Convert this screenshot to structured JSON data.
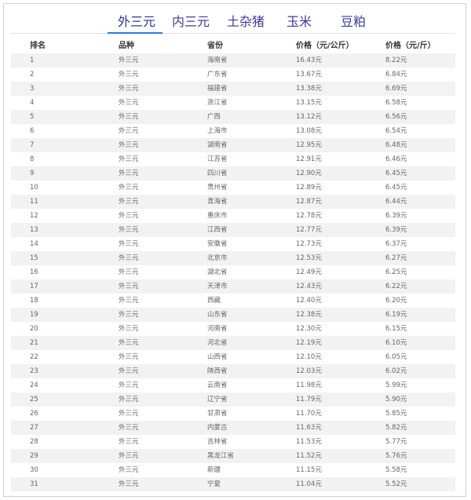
{
  "tabs": [
    {
      "label": "外三元",
      "active": true
    },
    {
      "label": "内三元",
      "active": false
    },
    {
      "label": "土杂猪",
      "active": false
    },
    {
      "label": "玉米",
      "active": false
    },
    {
      "label": "豆粕",
      "active": false
    }
  ],
  "table": {
    "headers": [
      "排名",
      "品种",
      "省份",
      "价格（元/公斤）",
      "价格（元/斤）"
    ],
    "rows": [
      [
        "1",
        "外三元",
        "海南省",
        "16.43元",
        "8.22元"
      ],
      [
        "2",
        "外三元",
        "广东省",
        "13.67元",
        "6.84元"
      ],
      [
        "3",
        "外三元",
        "福建省",
        "13.38元",
        "6.69元"
      ],
      [
        "4",
        "外三元",
        "浙江省",
        "13.15元",
        "6.58元"
      ],
      [
        "5",
        "外三元",
        "广西",
        "13.12元",
        "6.56元"
      ],
      [
        "6",
        "外三元",
        "上海市",
        "13.08元",
        "6.54元"
      ],
      [
        "7",
        "外三元",
        "湖南省",
        "12.95元",
        "6.48元"
      ],
      [
        "8",
        "外三元",
        "江苏省",
        "12.91元",
        "6.46元"
      ],
      [
        "9",
        "外三元",
        "四川省",
        "12.90元",
        "6.45元"
      ],
      [
        "10",
        "外三元",
        "贵州省",
        "12.89元",
        "6.45元"
      ],
      [
        "11",
        "外三元",
        "青海省",
        "12.87元",
        "6.44元"
      ],
      [
        "12",
        "外三元",
        "重庆市",
        "12.78元",
        "6.39元"
      ],
      [
        "13",
        "外三元",
        "江西省",
        "12.77元",
        "6.39元"
      ],
      [
        "14",
        "外三元",
        "安徽省",
        "12.73元",
        "6.37元"
      ],
      [
        "15",
        "外三元",
        "北京市",
        "12.53元",
        "6.27元"
      ],
      [
        "16",
        "外三元",
        "湖北省",
        "12.49元",
        "6.25元"
      ],
      [
        "17",
        "外三元",
        "天津市",
        "12.43元",
        "6.22元"
      ],
      [
        "18",
        "外三元",
        "西藏",
        "12.40元",
        "6.20元"
      ],
      [
        "19",
        "外三元",
        "山东省",
        "12.38元",
        "6.19元"
      ],
      [
        "20",
        "外三元",
        "河南省",
        "12.30元",
        "6.15元"
      ],
      [
        "21",
        "外三元",
        "河北省",
        "12.19元",
        "6.10元"
      ],
      [
        "22",
        "外三元",
        "山西省",
        "12.10元",
        "6.05元"
      ],
      [
        "23",
        "外三元",
        "陕西省",
        "12.03元",
        "6.02元"
      ],
      [
        "24",
        "外三元",
        "云南省",
        "11.98元",
        "5.99元"
      ],
      [
        "25",
        "外三元",
        "辽宁省",
        "11.79元",
        "5.90元"
      ],
      [
        "26",
        "外三元",
        "甘肃省",
        "11.70元",
        "5.85元"
      ],
      [
        "27",
        "外三元",
        "内蒙古",
        "11.63元",
        "5.82元"
      ],
      [
        "28",
        "外三元",
        "吉林省",
        "11.53元",
        "5.77元"
      ],
      [
        "29",
        "外三元",
        "黑龙江省",
        "11.52元",
        "5.76元"
      ],
      [
        "30",
        "外三元",
        "新疆",
        "11.15元",
        "5.58元"
      ],
      [
        "31",
        "外三元",
        "宁夏",
        "11.04元",
        "5.52元"
      ]
    ]
  },
  "colors": {
    "tab_text": "#3d3a9c",
    "tab_underline": "#2a7ae2",
    "stripe": "#f2f2f2"
  }
}
